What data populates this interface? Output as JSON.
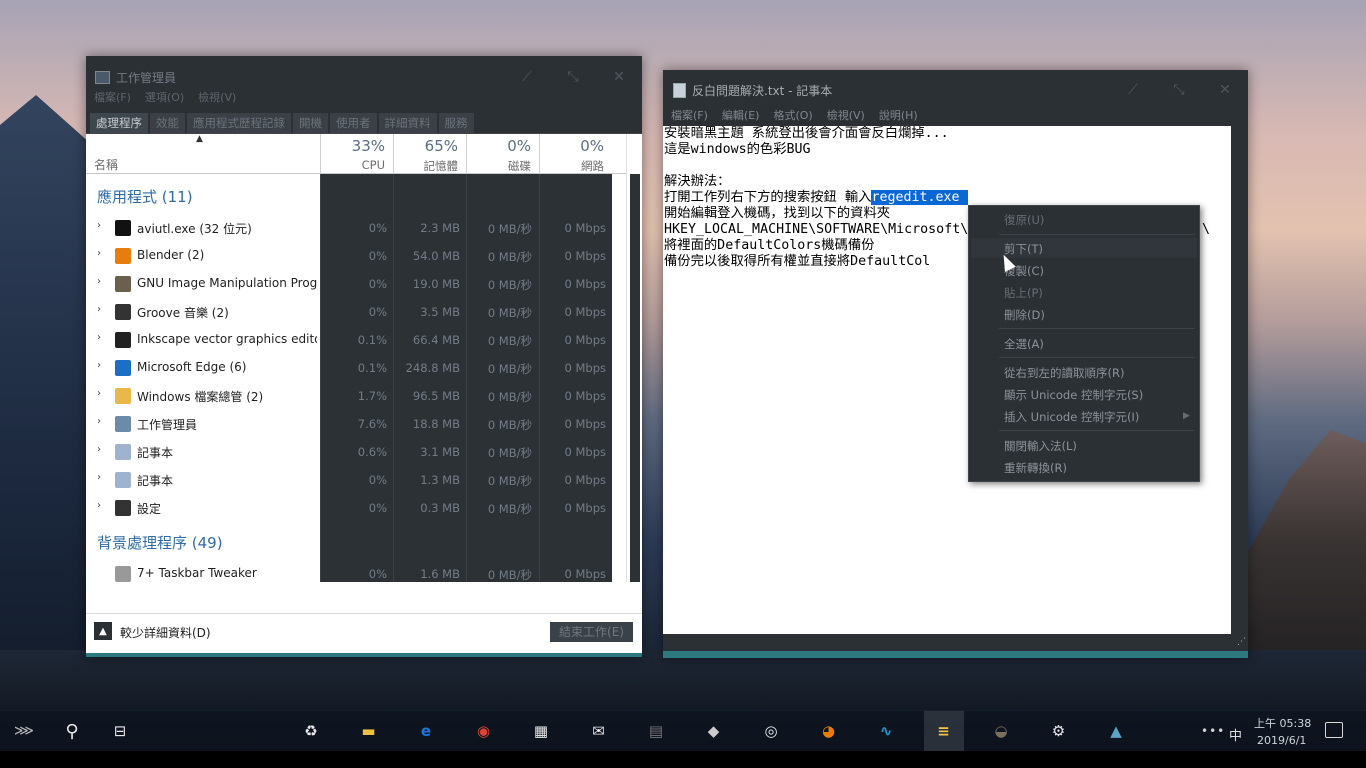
{
  "taskmanager": {
    "title": "工作管理員",
    "menu": [
      "檔案(F)",
      "選項(O)",
      "檢視(V)"
    ],
    "tabs": [
      "處理程序",
      "效能",
      "應用程式歷程記錄",
      "開機",
      "使用者",
      "詳細資料",
      "服務"
    ],
    "active_tab": 0,
    "columns": {
      "name": "名稱",
      "cpu_pct": "33%",
      "cpu": "CPU",
      "mem_pct": "65%",
      "mem": "記憶體",
      "disk_pct": "0%",
      "disk": "磁碟",
      "net_pct": "0%",
      "net": "網路"
    },
    "apps_group": "應用程式 (11)",
    "apps": [
      {
        "name": "aviutl.exe (32 位元)",
        "icon": "aviutl-icon",
        "cpu": "0%",
        "mem": "2.3 MB",
        "disk": "0 MB/秒",
        "net": "0 Mbps"
      },
      {
        "name": "Blender (2)",
        "icon": "blender-icon",
        "cpu": "0%",
        "mem": "54.0 MB",
        "disk": "0 MB/秒",
        "net": "0 Mbps"
      },
      {
        "name": "GNU Image Manipulation Progr...",
        "icon": "gimp-icon",
        "cpu": "0%",
        "mem": "19.0 MB",
        "disk": "0 MB/秒",
        "net": "0 Mbps"
      },
      {
        "name": "Groove 音樂 (2)",
        "icon": "groove-icon",
        "cpu": "0%",
        "mem": "3.5 MB",
        "disk": "0 MB/秒",
        "net": "0 Mbps"
      },
      {
        "name": "Inkscape vector graphics editor",
        "icon": "inkscape-icon",
        "cpu": "0.1%",
        "mem": "66.4 MB",
        "disk": "0 MB/秒",
        "net": "0 Mbps"
      },
      {
        "name": "Microsoft Edge (6)",
        "icon": "edge-icon",
        "cpu": "0.1%",
        "mem": "248.8 MB",
        "disk": "0 MB/秒",
        "net": "0 Mbps"
      },
      {
        "name": "Windows 檔案總管 (2)",
        "icon": "folder-icon",
        "cpu": "1.7%",
        "mem": "96.5 MB",
        "disk": "0 MB/秒",
        "net": "0 Mbps"
      },
      {
        "name": "工作管理員",
        "icon": "taskmanager-icon",
        "cpu": "7.6%",
        "mem": "18.8 MB",
        "disk": "0 MB/秒",
        "net": "0 Mbps"
      },
      {
        "name": "記事本",
        "icon": "notepad-icon",
        "cpu": "0.6%",
        "mem": "3.1 MB",
        "disk": "0 MB/秒",
        "net": "0 Mbps"
      },
      {
        "name": "記事本",
        "icon": "notepad-icon",
        "cpu": "0%",
        "mem": "1.3 MB",
        "disk": "0 MB/秒",
        "net": "0 Mbps"
      },
      {
        "name": "設定",
        "icon": "settings-icon",
        "cpu": "0%",
        "mem": "0.3 MB",
        "disk": "0 MB/秒",
        "net": "0 Mbps"
      }
    ],
    "bg_group": "背景處理程序 (49)",
    "bg": [
      {
        "name": "7+ Taskbar Tweaker",
        "icon": "taskbar-tweaker-icon",
        "cpu": "0%",
        "mem": "1.6 MB",
        "disk": "0 MB/秒",
        "net": "0 Mbps"
      }
    ],
    "fewer_details": "較少詳細資料(D)",
    "end_task": "結束工作(E)"
  },
  "notepad": {
    "title": "反白問題解決.txt - 記事本",
    "menu": [
      "檔案(F)",
      "編輯(E)",
      "格式(O)",
      "檢視(V)",
      "說明(H)"
    ],
    "lines": [
      "安裝暗黑主題 系統登出後會介面會反白爛掉...",
      "這是windows的色彩BUG",
      "",
      "解決辦法：",
      "打開工作列右下方的搜索按鈕 輸入",
      "開始編輯登入機碼，找到以下的資料夾",
      "HKEY_LOCAL_MACHINE\\SOFTWARE\\Microsoft\\",
      "將裡面的DefaultColors機碼備份",
      "備份完以後取得所有權並直接將DefaultCol"
    ],
    "line5_selected": "regedit.exe ",
    "line7_tail": "\\"
  },
  "context_menu": {
    "items": [
      {
        "label": "復原(U)",
        "enabled": false
      },
      {
        "label": "剪下(T)",
        "enabled": true
      },
      {
        "label": "複製(C)",
        "enabled": true
      },
      {
        "label": "貼上(P)",
        "enabled": false
      },
      {
        "label": "刪除(D)",
        "enabled": true
      },
      {
        "label": "全選(A)",
        "enabled": true
      },
      {
        "label": "從右到左的讀取順序(R)",
        "enabled": true
      },
      {
        "label": "顯示 Unicode 控制字元(S)",
        "enabled": true
      },
      {
        "label": "插入 Unicode 控制字元(I)",
        "enabled": true
      },
      {
        "label": "關閉輸入法(L)",
        "enabled": true
      },
      {
        "label": "重新轉換(R)",
        "enabled": true
      }
    ]
  },
  "taskbar": {
    "left": [
      "start-icon",
      "search-icon",
      "task-view-icon"
    ],
    "apps": [
      "recycle-bin-icon",
      "file-explorer-icon",
      "edge-icon",
      "chrome-icon",
      "store-icon",
      "mail-icon",
      "video-editor-icon",
      "inkscape-icon",
      "groove-icon",
      "blender-icon",
      "audacity-icon",
      "notepad-icon",
      "gimp-icon",
      "settings-icon",
      "photos-icon"
    ],
    "tray": {
      "ime": "中",
      "time": "上午 05:38",
      "date": "2019/6/1"
    }
  }
}
